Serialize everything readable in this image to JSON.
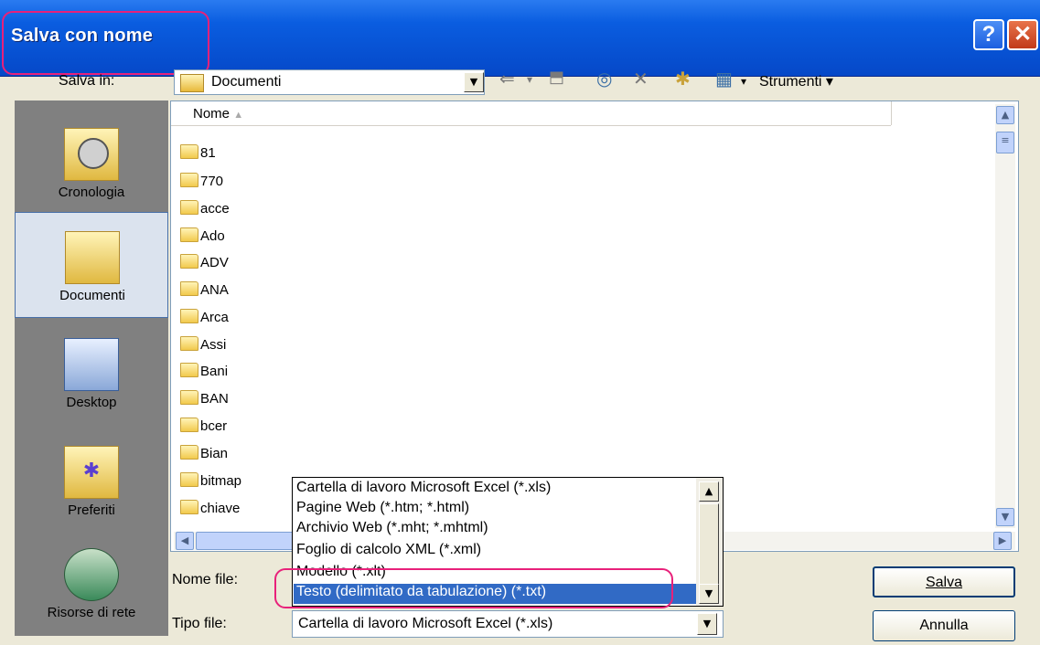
{
  "window": {
    "title": "Salva con nome",
    "help": "?",
    "close": "✕"
  },
  "toolbar": {
    "save_in_label": "Salva in:",
    "location": "Documenti",
    "tools_label": "Strumenti"
  },
  "places": [
    {
      "label": "Cronologia",
      "icon": "history-icon"
    },
    {
      "label": "Documenti",
      "icon": "my-documents-icon"
    },
    {
      "label": "Desktop",
      "icon": "desktop-icon"
    },
    {
      "label": "Preferiti",
      "icon": "favorites-icon"
    },
    {
      "label": "Risorse di rete",
      "icon": "network-places-icon"
    }
  ],
  "filelist": {
    "column_name": "Nome",
    "items": [
      "81",
      "770",
      "acce",
      "Ado",
      "ADV",
      "ANA",
      "Arca",
      "Assi",
      "Bani",
      "BAN",
      "bcer",
      "Bian",
      "bitmap",
      "chiave"
    ]
  },
  "form": {
    "filename_label": "Nome file:",
    "filetype_label": "Tipo file:",
    "filetype_value": "Cartella di lavoro Microsoft Excel (*.xls)"
  },
  "type_options": [
    "Cartella di lavoro Microsoft Excel (*.xls)",
    "Pagine Web (*.htm; *.html)",
    "Archivio Web (*.mht; *.mhtml)",
    "Foglio di calcolo XML (*.xml)",
    "Modello (*.xlt)",
    "Testo (delimitato da tabulazione) (*.txt)"
  ],
  "buttons": {
    "save": "Salva",
    "cancel": "Annulla"
  },
  "colors": {
    "highlight": "#316ac5",
    "annotation": "#e8217a",
    "titlebar": "#0a5de0"
  }
}
